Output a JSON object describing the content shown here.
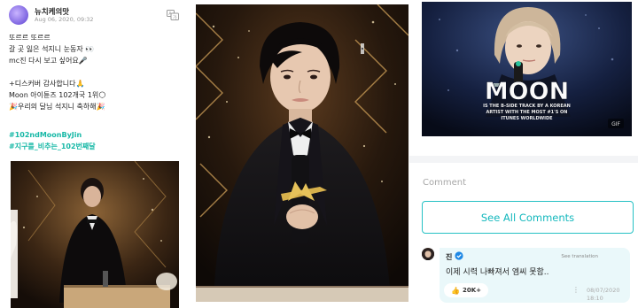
{
  "post": {
    "author": "뉴치케의맛",
    "date": "Aug 06, 2020, 09:32",
    "lines": [
      "또르르 또르르",
      "갈 곳 잃은 석지니 눈동자 👀",
      "mc진 다시 보고 싶어요🎤",
      "",
      " +디스커버 감사합니다🙏",
      "Moon 아이튠즈 102개국 1위🌕",
      "🎉우리의 달님 석지니 축하해🎉"
    ],
    "hashtags": [
      "#102ndMoonByJin",
      "#지구를_비추는_102번째달"
    ]
  },
  "promo_image": {
    "title": "MOON",
    "subtitle_lines": [
      "IS THE B-SIDE TRACK BY A KOREAN",
      "ARTIST WITH THE MOST #1'S ON",
      "ITUNES WORLDWIDE"
    ],
    "corner_mark": "GIF"
  },
  "comments": {
    "section_label": "Comment",
    "see_all_label": "See All Comments",
    "item": {
      "name": "진",
      "see_translation": "See translation",
      "text": "이제 시력 나빠져서 엠씨 못함..",
      "likes": "20K+",
      "more": "⋮",
      "date_line1": "08/07/2020",
      "date_line2": "18:10"
    }
  },
  "colors": {
    "accent": "#14b8bd",
    "hashtag": "#16b8a6",
    "comment_bubble": "#eaf8fa"
  }
}
